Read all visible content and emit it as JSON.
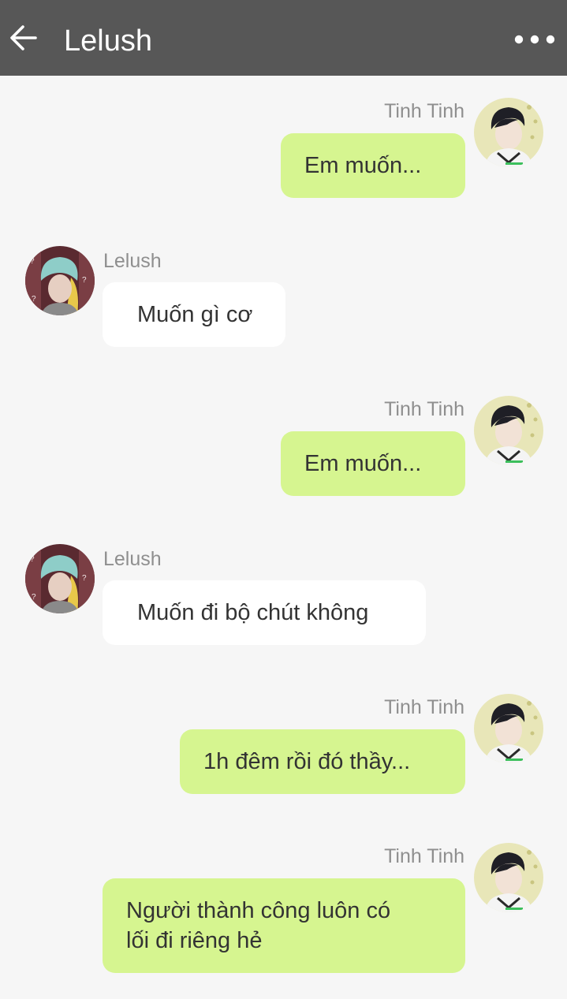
{
  "header": {
    "title": "Lelush",
    "back_icon": "arrow-left-icon",
    "more_icon": "more-horizontal-icon",
    "background": "#575757"
  },
  "colors": {
    "my_bubble": "#d6f590",
    "their_bubble": "#ffffff",
    "chat_background": "#f6f6f6",
    "name_text": "#8f8f8f"
  },
  "messages": [
    {
      "sender": "Tinh Tinh",
      "side": "right",
      "text": "Em muốn..."
    },
    {
      "sender": "Lelush",
      "side": "left",
      "text": "Muốn gì cơ"
    },
    {
      "sender": "Tinh Tinh",
      "side": "right",
      "text": "Em muốn..."
    },
    {
      "sender": "Lelush",
      "side": "left",
      "text": "Muốn đi bộ chút không"
    },
    {
      "sender": "Tinh Tinh",
      "side": "right",
      "text": "1h đêm rồi đó thầy..."
    },
    {
      "sender": "Tinh Tinh",
      "side": "right",
      "text": "Người thành công luôn có\nlối đi riêng hẻ"
    }
  ]
}
